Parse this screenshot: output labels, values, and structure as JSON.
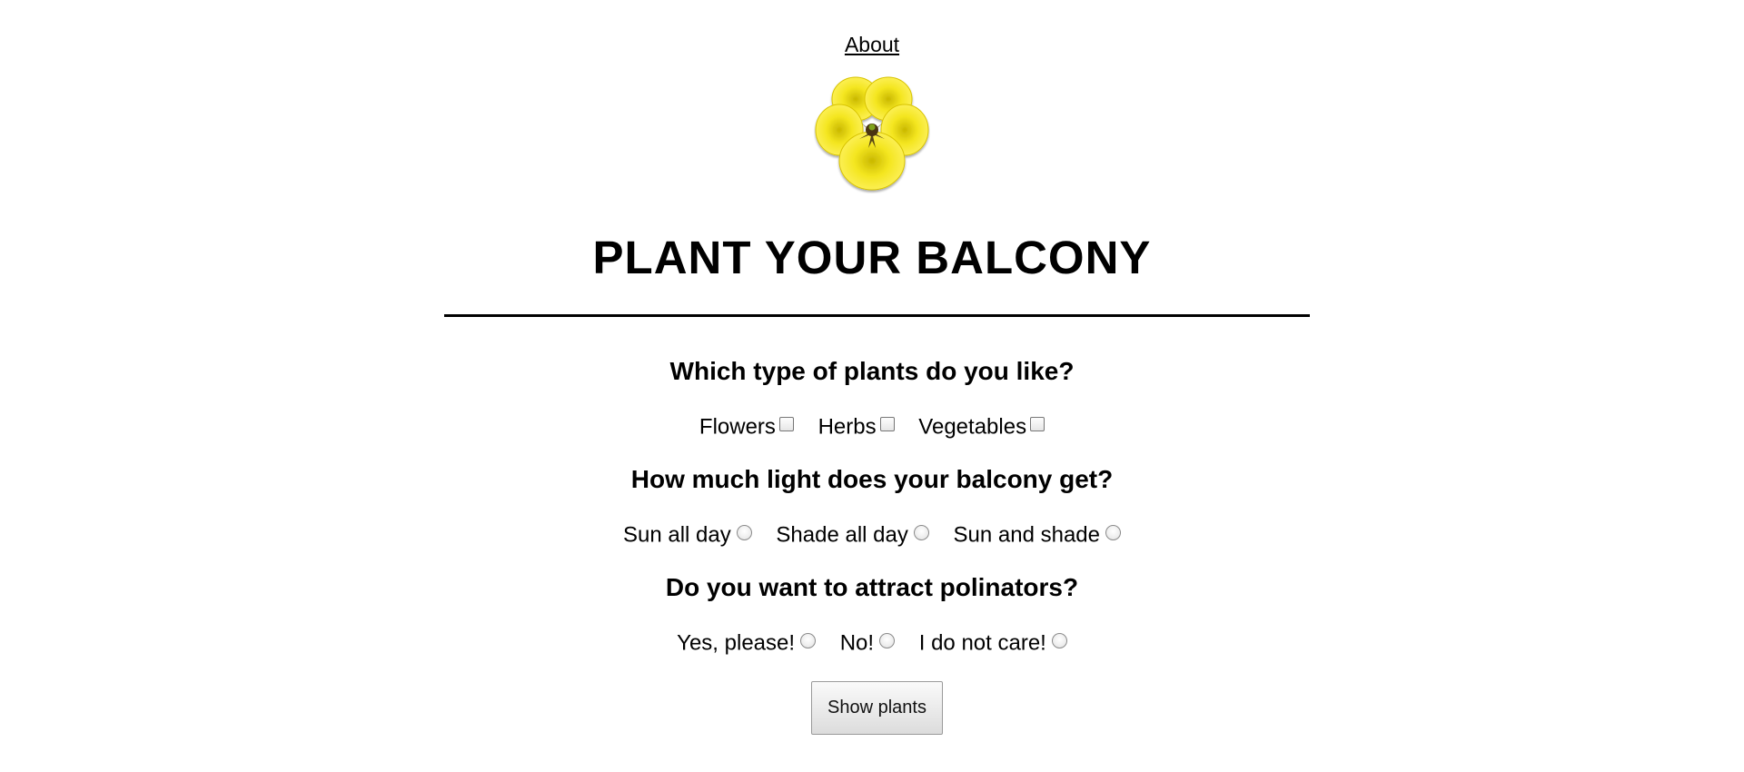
{
  "nav": {
    "about_label": "About"
  },
  "logo": {
    "icon": "yellow-pansy-flower-icon",
    "petal_color": "#f2e51c",
    "center_color": "#3a2a10"
  },
  "title": "PLANT YOUR BALCONY",
  "questions": [
    {
      "text": "Which type of plants do you like?",
      "input_type": "checkbox",
      "options": [
        {
          "label": "Flowers",
          "checked": false
        },
        {
          "label": "Herbs",
          "checked": false
        },
        {
          "label": "Vegetables",
          "checked": false
        }
      ]
    },
    {
      "text": "How much light does your balcony get?",
      "input_type": "radio",
      "options": [
        {
          "label": "Sun all day",
          "checked": false
        },
        {
          "label": "Shade all day",
          "checked": false
        },
        {
          "label": "Sun and shade",
          "checked": false
        }
      ]
    },
    {
      "text": "Do you want to attract polinators?",
      "input_type": "radio",
      "options": [
        {
          "label": "Yes, please!",
          "checked": false
        },
        {
          "label": "No!",
          "checked": false
        },
        {
          "label": "I do not care!",
          "checked": false
        }
      ]
    }
  ],
  "submit_label": "Show plants"
}
